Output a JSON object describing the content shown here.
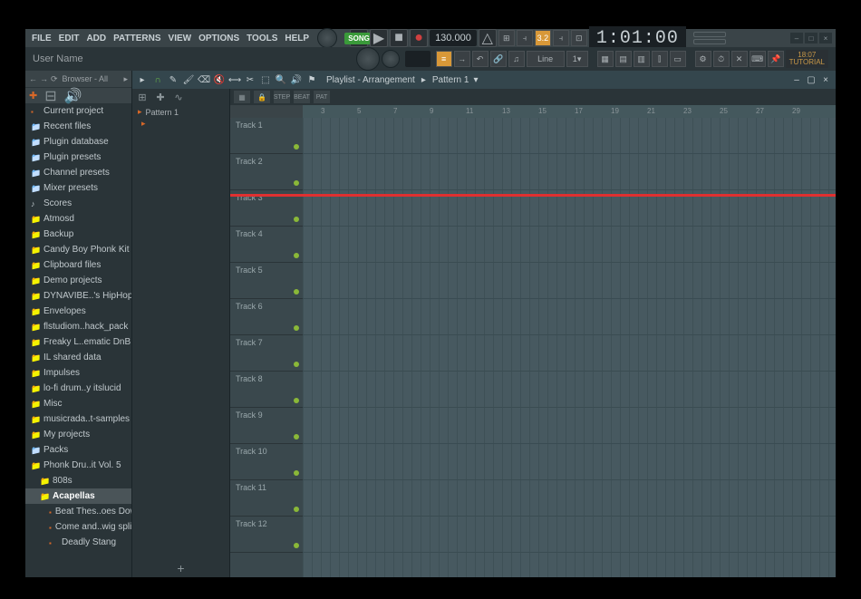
{
  "menu": [
    "FILE",
    "EDIT",
    "ADD",
    "PATTERNS",
    "VIEW",
    "OPTIONS",
    "TOOLS",
    "HELP"
  ],
  "hint": "User Name",
  "transport": {
    "song_mode": "SONG",
    "tempo": "130.000",
    "time": "1:01:00"
  },
  "info_badge": {
    "line1": "18:07",
    "line2": "TUTORIAL"
  },
  "mini_buttons": [
    "⊞",
    "⫞",
    "3.2",
    "⫞",
    "⊡"
  ],
  "toolbar2_line": "Line",
  "toolbar2_num": "1",
  "browser": {
    "title": "Browser - All",
    "items": [
      {
        "label": "Current project",
        "icon": "file-o",
        "type": "b"
      },
      {
        "label": "Recent files",
        "icon": "folder-g"
      },
      {
        "label": "Plugin database",
        "icon": "folder-g"
      },
      {
        "label": "Plugin presets",
        "icon": "folder-g"
      },
      {
        "label": "Channel presets",
        "icon": "folder-g"
      },
      {
        "label": "Mixer presets",
        "icon": "folder-g"
      },
      {
        "label": "Scores",
        "icon": "note"
      },
      {
        "label": "Atmosd",
        "icon": "folder-y"
      },
      {
        "label": "Backup",
        "icon": "folder-y"
      },
      {
        "label": "Candy Boy Phonk Kit",
        "icon": "folder-y"
      },
      {
        "label": "Clipboard files",
        "icon": "folder-y"
      },
      {
        "label": "Demo projects",
        "icon": "folder-y"
      },
      {
        "label": "DYNAVIBE..'s HipHop",
        "icon": "folder-y"
      },
      {
        "label": "Envelopes",
        "icon": "folder-y"
      },
      {
        "label": "flstudiom..hack_pack",
        "icon": "folder-y"
      },
      {
        "label": "Freaky L..ematic DnB",
        "icon": "folder-y"
      },
      {
        "label": "IL shared data",
        "icon": "folder-y"
      },
      {
        "label": "Impulses",
        "icon": "folder-y"
      },
      {
        "label": "lo-fi drum..y itslucid",
        "icon": "folder-y"
      },
      {
        "label": "Misc",
        "icon": "folder-y"
      },
      {
        "label": "musicrada..t-samples",
        "icon": "folder-y"
      },
      {
        "label": "My projects",
        "icon": "folder-y"
      },
      {
        "label": "Packs",
        "icon": "folder-g"
      },
      {
        "label": "Phonk Dru..it Vol. 5",
        "icon": "folder-y",
        "indent": 0
      },
      {
        "label": "808s",
        "icon": "folder-y",
        "indent": 1
      },
      {
        "label": "Acapellas",
        "icon": "folder-y",
        "indent": 1,
        "selected": true
      },
      {
        "label": "Beat Thes..oes Down",
        "icon": "file-o",
        "indent": 2
      },
      {
        "label": "Come and..wig split",
        "icon": "file-o",
        "indent": 2
      },
      {
        "label": "Deadly Stang",
        "icon": "file-o",
        "indent": 2
      }
    ]
  },
  "playlist": {
    "title": "Playlist - Arrangement",
    "pattern": "Pattern 1",
    "picker_pattern": "Pattern 1",
    "ruler": [
      3,
      5,
      7,
      9,
      11,
      13,
      15,
      17,
      19,
      21,
      23,
      25,
      27,
      29
    ],
    "tracks": [
      "Track 1",
      "Track 2",
      "Track 3",
      "Track 4",
      "Track 5",
      "Track 6",
      "Track 7",
      "Track 8",
      "Track 9",
      "Track 10",
      "Track 11",
      "Track 12"
    ]
  }
}
